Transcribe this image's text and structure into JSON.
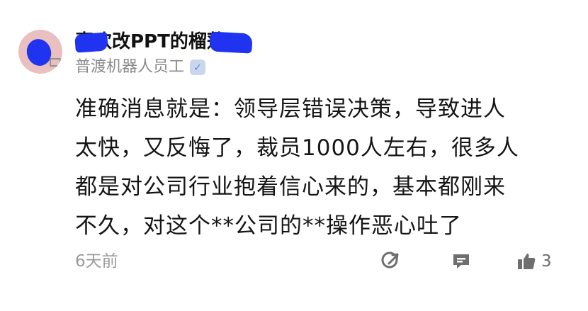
{
  "post": {
    "author_name": "喜欢改PPT的榴莲",
    "author_org": "普渡机器人员工",
    "verified_icon": "verified-check-icon",
    "content_lines": [
      "准确消息就是：领导层错误决策，导致进人",
      "太快，又反悔了，裁员1000人左右，很多人",
      "都是对公司行业抱着信心来的，基本都刚来",
      "不久，对这个**公司的**操作恶心吐了"
    ],
    "time": "6天前",
    "actions": {
      "share_icon": "share-edit-icon",
      "comment_icon": "comment-icon",
      "like_icon": "thumbs-up-icon",
      "like_count": "3"
    },
    "redaction_color": "#1f33f0"
  }
}
